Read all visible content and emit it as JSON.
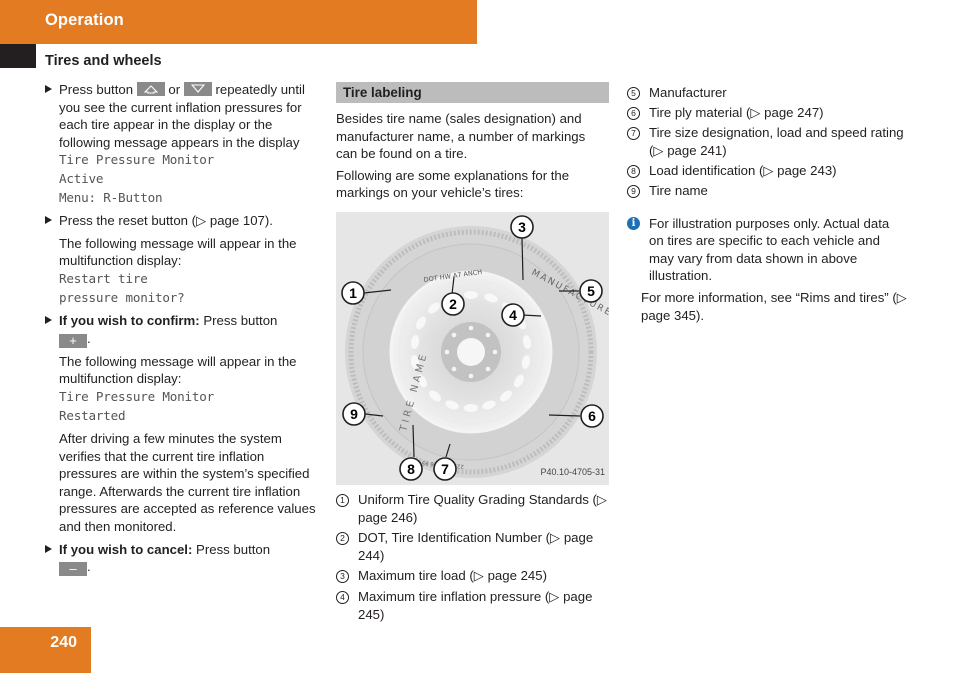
{
  "header": {
    "chapter": "Operation",
    "section": "Tires and wheels",
    "accent_color": "#e37b22"
  },
  "left_column": {
    "step1": {
      "before": "Press button",
      "or": "or",
      "after": "repeatedly until you see the current inflation pressures for each tire appear in the display or the following message appears in the display",
      "key_up_icon": "arrow-up-key",
      "key_down_icon": "arrow-down-key",
      "display": [
        "Tire Pressure Monitor",
        "Active",
        "Menu: R-Button"
      ]
    },
    "step2": {
      "text": "Press the reset button (▷ page 107).",
      "follow": "The following message will appear in the multifunction display:",
      "display": [
        "Restart tire",
        "pressure monitor?"
      ]
    },
    "step3": {
      "bold": "If you wish to confirm:",
      "text": "Press button",
      "key_label": "+",
      "follow": "The following message will appear in the multifunction display:",
      "display": [
        "Tire Pressure Monitor",
        "Restarted"
      ],
      "after": "After driving a few minutes the system verifies that the current tire inflation pressures are within the system’s specified range. Afterwards the current tire inflation pressures are accepted as reference values and then monitored."
    },
    "step4": {
      "bold": "If you wish to cancel:",
      "text": "Press button",
      "key_label": "–"
    }
  },
  "middle_column": {
    "subheading": "Tire labeling",
    "intro1": "Besides tire name (sales designation) and manufacturer name, a number of markings can be found on a tire.",
    "intro2": "Following are some explanations for the markings on your vehicle’s tires:",
    "figure": {
      "code": "P40.10-4705-31",
      "sidewall_text": {
        "tire_name": "TIRE NAME",
        "manufacturer": "MANUFACTURER",
        "dot": "DOT HW A7 ANCH",
        "size": "225/55 R 16 95 H"
      },
      "callouts": [
        "1",
        "2",
        "3",
        "4",
        "5",
        "6",
        "7",
        "8",
        "9"
      ]
    },
    "legend": [
      {
        "num": "1",
        "text": "Uniform Tire Quality Grading Standards (▷ page 246)"
      },
      {
        "num": "2",
        "text": "DOT, Tire Identification Number (▷ page 244)"
      },
      {
        "num": "3",
        "text": "Maximum tire load (▷ page 245)"
      },
      {
        "num": "4",
        "text": "Maximum tire inflation pressure (▷ page 245)"
      }
    ]
  },
  "right_column": {
    "legend": [
      {
        "num": "5",
        "text": "Manufacturer"
      },
      {
        "num": "6",
        "text": "Tire ply material (▷ page 247)"
      },
      {
        "num": "7",
        "text": "Tire size designation, load and speed rating (▷ page 241)"
      },
      {
        "num": "8",
        "text": "Load identification (▷ page 243)"
      },
      {
        "num": "9",
        "text": "Tire name"
      }
    ],
    "note": {
      "icon": "i",
      "text": "For illustration purposes only. Actual data on tires are specific to each vehicle and may vary from data shown in above illustration.",
      "more": "For more information, see “Rims and tires” (▷ page 345)."
    }
  },
  "footer": {
    "page_number": "240"
  }
}
